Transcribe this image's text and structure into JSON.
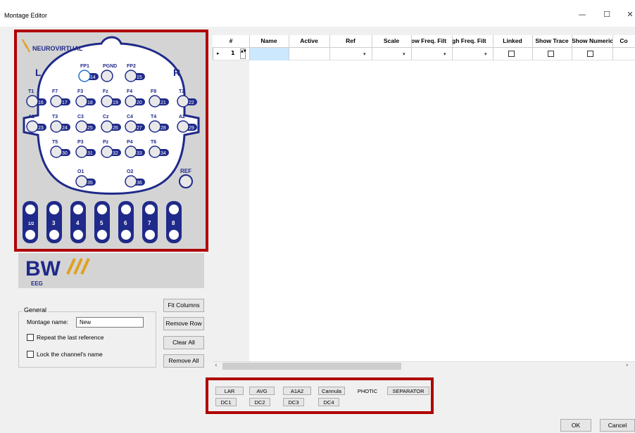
{
  "window": {
    "title": "Montage Editor",
    "minimize": "—",
    "maximize": "☐",
    "close": "✕"
  },
  "head": {
    "brand": "NEUROVIRTUAL",
    "left": "L",
    "right": "R",
    "ref": "REF",
    "electrodes": [
      {
        "label": "FP1",
        "num": "14"
      },
      {
        "label": "PGND",
        "num": ""
      },
      {
        "label": "FP2",
        "num": "15"
      },
      {
        "label": "T1",
        "num": "16"
      },
      {
        "label": "F7",
        "num": "17"
      },
      {
        "label": "F3",
        "num": "18"
      },
      {
        "label": "Fz",
        "num": "19"
      },
      {
        "label": "F4",
        "num": "20"
      },
      {
        "label": "F8",
        "num": "21"
      },
      {
        "label": "T2",
        "num": "22"
      },
      {
        "label": "A1",
        "num": "23"
      },
      {
        "label": "T3",
        "num": "24"
      },
      {
        "label": "C3",
        "num": "25"
      },
      {
        "label": "Cz",
        "num": "26"
      },
      {
        "label": "C4",
        "num": "27"
      },
      {
        "label": "T4",
        "num": "28"
      },
      {
        "label": "A2",
        "num": "29"
      },
      {
        "label": "T5",
        "num": "30"
      },
      {
        "label": "P3",
        "num": "31"
      },
      {
        "label": "Pz",
        "num": "32"
      },
      {
        "label": "P4",
        "num": "33"
      },
      {
        "label": "T6",
        "num": "34"
      },
      {
        "label": "O1",
        "num": "35"
      },
      {
        "label": "O2",
        "num": "36"
      }
    ],
    "bipolar": [
      "1",
      "2",
      "3",
      "4",
      "5",
      "6",
      "7",
      "8"
    ]
  },
  "logo": {
    "mark": "BW",
    "sub": "EEG"
  },
  "general": {
    "legend": "General",
    "montage_label": "Montage name:",
    "montage_value": "New",
    "repeat_label": "Repeat the last reference",
    "lock_label": "Lock the channel's name"
  },
  "side_buttons": {
    "fit": "Fit Columns",
    "remove_row": "Remove Row",
    "clear": "Clear All",
    "remove_all": "Remove All"
  },
  "grid": {
    "columns": [
      "#",
      "Name",
      "Active",
      "Ref",
      "Scale",
      "ow Freq. Filt",
      "gh Freq. Filt",
      "Linked",
      "Show Trace",
      "Show Numeric",
      "Co"
    ],
    "row": {
      "arrow": "▸",
      "index": "1"
    }
  },
  "presets": [
    "LAR",
    "AVG",
    "A1A2",
    "Cannula",
    "PHOTIC",
    "SEPARATOR",
    "DC1",
    "DC2",
    "DC3",
    "DC4"
  ],
  "dialog": {
    "ok": "OK",
    "cancel": "Cancel"
  }
}
